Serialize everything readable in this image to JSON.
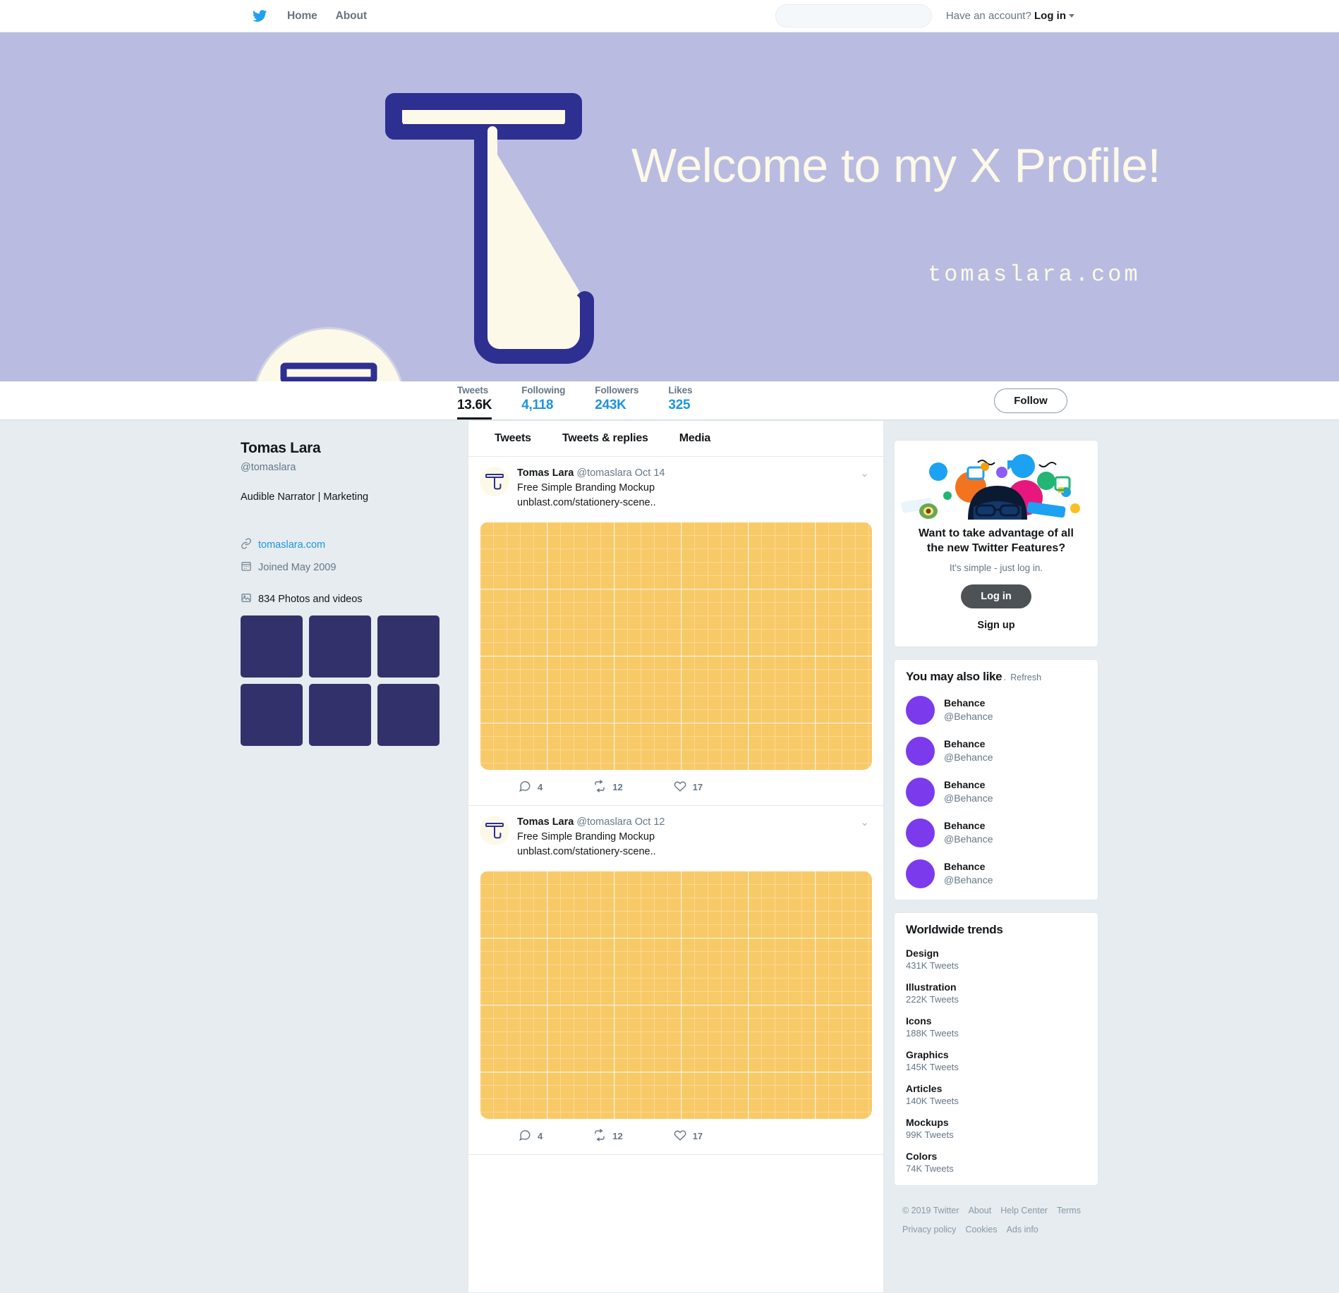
{
  "nav": {
    "logo_icon": "twitter-bird-icon",
    "items": [
      {
        "label": "Home",
        "icon": "home-link"
      },
      {
        "label": "About",
        "icon": "about-link"
      }
    ],
    "search_placeholder": "",
    "search_value": "",
    "account_prompt": "Have an account?",
    "login_label": "Log in"
  },
  "banner": {
    "title": "Welcome to my X Profile!",
    "url": "tomaslara.com",
    "bg_color": "#b9bce0",
    "logo_navy": "#2d2f91",
    "logo_cream": "#fdf9e8"
  },
  "stats": {
    "items": [
      {
        "label": "Tweets",
        "value": "13.6K",
        "active": true
      },
      {
        "label": "Following",
        "value": "4,118",
        "active": false
      },
      {
        "label": "Followers",
        "value": "243K",
        "active": false
      },
      {
        "label": "Likes",
        "value": "325",
        "active": false
      }
    ],
    "follow_label": "Follow"
  },
  "profile": {
    "name": "Tomas Lara",
    "handle": "@tomaslara",
    "bio": "Audible Narrator | Marketing",
    "website": "tomaslara.com",
    "joined": "Joined May 2009",
    "photos_label": "834 Photos and videos",
    "thumb_color": "#33316b",
    "thumbs": [
      1,
      2,
      3,
      4,
      5,
      6
    ]
  },
  "timeline": {
    "tabs": [
      {
        "label": "Tweets",
        "active": true
      },
      {
        "label": "Tweets & replies",
        "active": false
      },
      {
        "label": "Media",
        "active": false
      }
    ],
    "tweets": [
      {
        "name": "Tomas Lara",
        "handle": "@tomaslara",
        "date": "Oct 14",
        "text": "Free Simple Branding Mockup",
        "url": "unblast.com/stationery-scene..",
        "replies": "4",
        "retweets": "12",
        "likes": "17",
        "image_color": "#f8c967"
      },
      {
        "name": "Tomas Lara",
        "handle": "@tomaslara",
        "date": "Oct 12",
        "text": "Free Simple Branding Mockup",
        "url": "unblast.com/stationery-scene..",
        "replies": "4",
        "retweets": "12",
        "likes": "17",
        "image_color": "#f8c967"
      }
    ]
  },
  "promo": {
    "title": "Want to take advantage of all the new Twitter Features?",
    "subtitle": "It's simple - just log in.",
    "login_label": "Log in",
    "signup_label": "Sign up"
  },
  "suggestions": {
    "title": "You may also like",
    "separator": ".",
    "refresh_label": "Refresh",
    "accent_color": "#7c3aed",
    "items": [
      {
        "name": "Behance",
        "handle": "@Behance"
      },
      {
        "name": "Behance",
        "handle": "@Behance"
      },
      {
        "name": "Behance",
        "handle": "@Behance"
      },
      {
        "name": "Behance",
        "handle": "@Behance"
      },
      {
        "name": "Behance",
        "handle": "@Behance"
      }
    ]
  },
  "trends": {
    "title": "Worldwide trends",
    "items": [
      {
        "name": "Design",
        "count": "431K Tweets"
      },
      {
        "name": "Illustration",
        "count": "222K Tweets"
      },
      {
        "name": "Icons",
        "count": "188K Tweets"
      },
      {
        "name": "Graphics",
        "count": "145K Tweets"
      },
      {
        "name": "Articles",
        "count": "140K Tweets"
      },
      {
        "name": "Mockups",
        "count": "99K Tweets"
      },
      {
        "name": "Colors",
        "count": "74K Tweets"
      }
    ]
  },
  "footer": {
    "copyright": "© 2019 Twitter",
    "links": [
      "About",
      "Help Center",
      "Terms",
      "Privacy policy",
      "Cookies",
      "Ads info"
    ]
  }
}
